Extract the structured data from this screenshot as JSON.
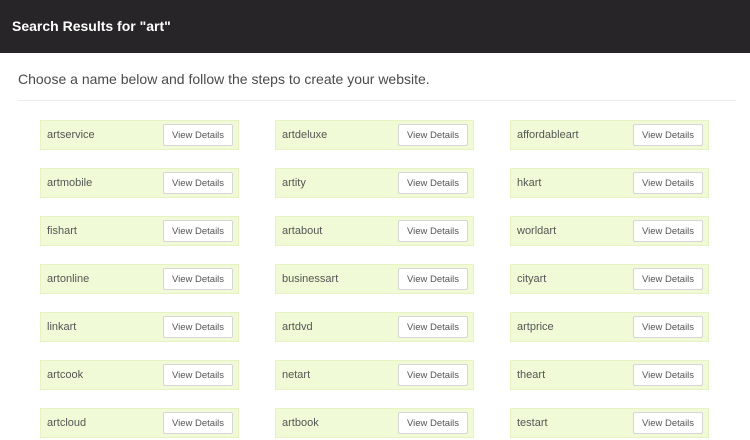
{
  "header": {
    "title": "Search Results for \"art\""
  },
  "intro": {
    "text": "Choose a name below and follow the steps to create your website."
  },
  "button_label": "View Details",
  "results": [
    {
      "name": "artservice",
      "button": "View Details"
    },
    {
      "name": "artdeluxe",
      "button": "View Details"
    },
    {
      "name": "affordableart",
      "button": "View Details"
    },
    {
      "name": "artmobile",
      "button": "View Details"
    },
    {
      "name": "artity",
      "button": "View Details"
    },
    {
      "name": "hkart",
      "button": "View Details"
    },
    {
      "name": "fishart",
      "button": "View Details"
    },
    {
      "name": "artabout",
      "button": "View Details"
    },
    {
      "name": "worldart",
      "button": "View Details"
    },
    {
      "name": "artonline",
      "button": "View Details"
    },
    {
      "name": "businessart",
      "button": "View Details"
    },
    {
      "name": "cityart",
      "button": "View Details"
    },
    {
      "name": "linkart",
      "button": "View Details"
    },
    {
      "name": "artdvd",
      "button": "View Details"
    },
    {
      "name": "artprice",
      "button": "View Details"
    },
    {
      "name": "artcook",
      "button": "View Details"
    },
    {
      "name": "netart",
      "button": "View Details"
    },
    {
      "name": "theart",
      "button": "View Details"
    },
    {
      "name": "artcloud",
      "button": "View Details"
    },
    {
      "name": "artbook",
      "button": "View Details"
    },
    {
      "name": "testart",
      "button": "View Details"
    }
  ],
  "colors": {
    "header_bg": "#272527",
    "card_bg": "#f1fad6",
    "text": "#555555"
  }
}
